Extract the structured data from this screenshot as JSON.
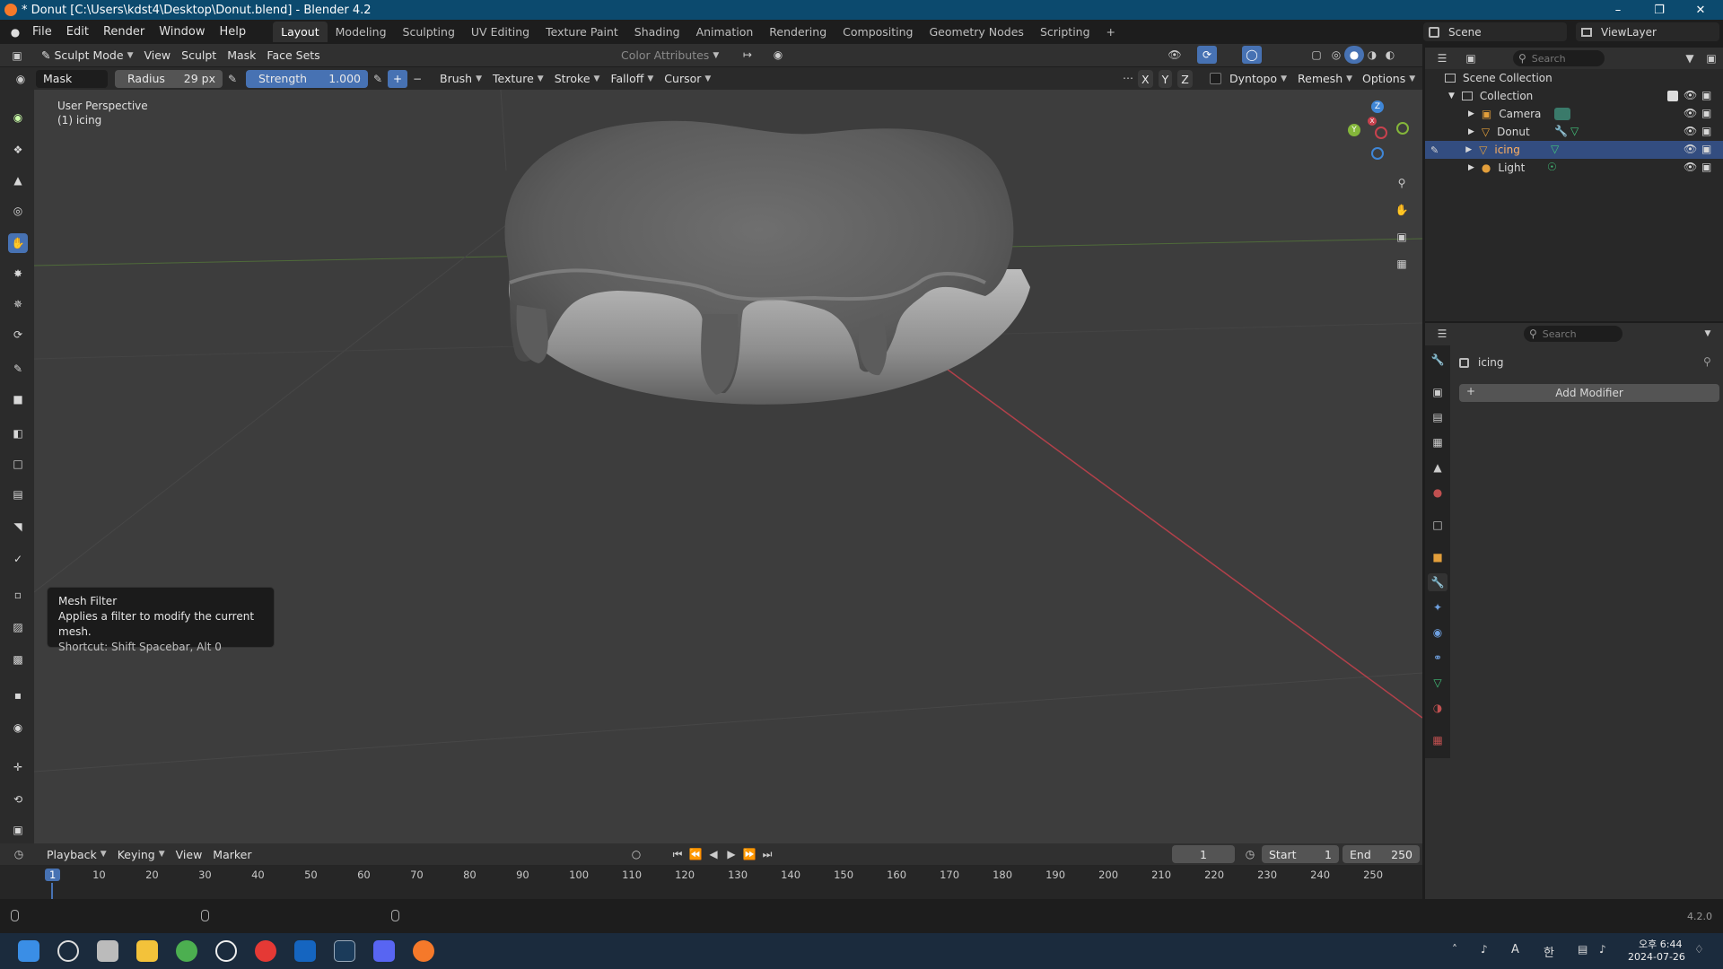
{
  "window": {
    "title": "* Donut [C:\\Users\\kdst4\\Desktop\\Donut.blend] - Blender 4.2"
  },
  "menu": [
    "File",
    "Edit",
    "Render",
    "Window",
    "Help"
  ],
  "workspaces": [
    "Layout",
    "Modeling",
    "Sculpting",
    "UV Editing",
    "Texture Paint",
    "Shading",
    "Animation",
    "Rendering",
    "Compositing",
    "Geometry Nodes",
    "Scripting"
  ],
  "scene": {
    "scene_name": "Scene",
    "view_layer": "ViewLayer"
  },
  "viewport_header": {
    "mode": "Sculpt Mode",
    "menus": [
      "View",
      "Sculpt",
      "Mask",
      "Face Sets"
    ],
    "color_attributes": "Color Attributes"
  },
  "tool_header": {
    "tool": "Mask",
    "radius_label": "Radius",
    "radius_value": "29 px",
    "strength_label": "Strength",
    "strength_value": "1.000",
    "menus": [
      "Brush",
      "Texture",
      "Stroke",
      "Falloff",
      "Cursor"
    ],
    "axes": [
      "X",
      "Y",
      "Z"
    ],
    "dyntopo": "Dyntopo",
    "remesh": "Remesh",
    "options": "Options"
  },
  "viewport": {
    "perspective": "User Perspective",
    "object": "(1) icing",
    "gizmo_axes": [
      "Z",
      "Y",
      "X"
    ]
  },
  "tooltip": {
    "title": "Mesh Filter",
    "desc": "Applies a filter to modify the current mesh.",
    "shortcut": "Shortcut: Shift Spacebar, Alt 0"
  },
  "outliner": {
    "search_placeholder": "Search",
    "scene_collection": "Scene Collection",
    "collection": "Collection",
    "objects": [
      "Camera",
      "Donut",
      "icing",
      "Light"
    ]
  },
  "properties": {
    "search_placeholder": "Search",
    "object_name": "icing",
    "add_modifier": "Add Modifier"
  },
  "timeline": {
    "menus": [
      "Playback",
      "Keying",
      "View",
      "Marker"
    ],
    "current_frame": "1",
    "start_label": "Start",
    "start": "1",
    "end_label": "End",
    "end": "250",
    "ticks": [
      "1",
      "10",
      "20",
      "30",
      "40",
      "50",
      "60",
      "70",
      "80",
      "90",
      "100",
      "110",
      "120",
      "130",
      "140",
      "150",
      "160",
      "170",
      "180",
      "190",
      "200",
      "210",
      "220",
      "230",
      "240",
      "250"
    ]
  },
  "status": {
    "version": "4.2.0"
  },
  "taskbar": {
    "time": "오후 6:44",
    "date": "2024-07-26",
    "ime_a": "A",
    "ime_han": "한"
  },
  "colors": {
    "accent": "#4772b3",
    "title_bar": "#0c4a6e",
    "viewport": "#3d3d3d"
  }
}
